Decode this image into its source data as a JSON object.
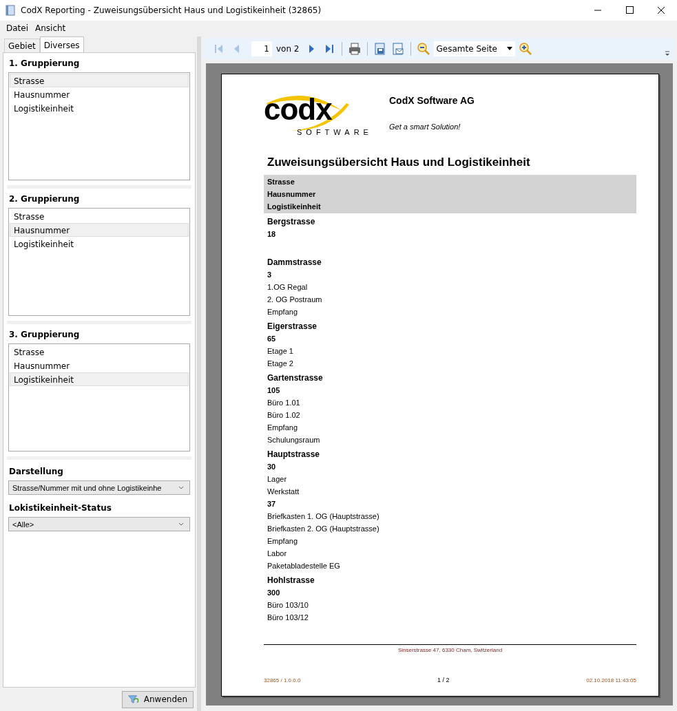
{
  "window": {
    "title": "CodX Reporting - Zuweisungsübersicht Haus und Logistikeinheit (32865)"
  },
  "menu": [
    "Datei",
    "Ansicht"
  ],
  "tabs": [
    {
      "label": "Gebiet",
      "selected": false
    },
    {
      "label": "Diverses",
      "selected": true
    }
  ],
  "groupings": [
    {
      "title": "1. Gruppierung",
      "items": [
        {
          "label": "Strasse",
          "selected": true
        },
        {
          "label": "Hausnummer",
          "selected": false
        },
        {
          "label": "Logistikeinheit",
          "selected": false
        }
      ]
    },
    {
      "title": "2. Gruppierung",
      "items": [
        {
          "label": "Strasse",
          "selected": false
        },
        {
          "label": "Hausnummer",
          "selected": true
        },
        {
          "label": "Logistikeinheit",
          "selected": false
        }
      ]
    },
    {
      "title": "3. Gruppierung",
      "items": [
        {
          "label": "Strasse",
          "selected": false
        },
        {
          "label": "Hausnummer",
          "selected": false
        },
        {
          "label": "Logistikeinheit",
          "selected": true
        }
      ]
    }
  ],
  "darstellung": {
    "label": "Darstellung",
    "value": "Strasse/Nummer mit und ohne Logistikeinhe"
  },
  "status": {
    "label": "Lokistikeinheit-Status",
    "value": "<Alle>"
  },
  "apply_button": "Anwenden",
  "toolbar": {
    "page": "1",
    "page_total": "von 2",
    "zoom": "Gesamte Seite"
  },
  "report": {
    "company": "CodX Software AG",
    "logo_text": "codx",
    "logo_sub": "SOFTWARE",
    "slogan": "Get a smart Solution!",
    "title": "Zuweisungsübersicht Haus und Logistikeinheit",
    "header": [
      "Strasse",
      "Hausnummer",
      "Logistikeinheit"
    ],
    "groups": [
      {
        "street": "Bergstrasse",
        "numbers": [
          {
            "number": "18"
          }
        ]
      },
      {
        "street": "Dammstrasse",
        "numbers": [
          {
            "number": "3",
            "units": [
              "1.OG Regal",
              "2. OG Postraum",
              "Empfang"
            ]
          }
        ]
      },
      {
        "street": "Eigerstrasse",
        "numbers": [
          {
            "number": "65",
            "units": [
              "Etage 1",
              "Etage 2"
            ]
          }
        ]
      },
      {
        "street": "Gartenstrasse",
        "numbers": [
          {
            "number": "105",
            "units": [
              "Büro 1.01",
              "Büro 1.02",
              "Empfang",
              "Schulungsraum"
            ]
          }
        ]
      },
      {
        "street": "Hauptstrasse",
        "numbers": [
          {
            "number": "30",
            "units": [
              "Lager",
              "Werkstatt"
            ]
          },
          {
            "number": "37",
            "units": [
              "Briefkasten 1. OG (Hauptstrasse)",
              "Briefkasten 2. OG  (Hauptstrasse)",
              "Empfang",
              "Labor",
              "Paketabladestelle EG"
            ]
          }
        ]
      },
      {
        "street": "Hohlstrasse",
        "numbers": [
          {
            "number": "300",
            "units": [
              "Büro 103/10",
              "Büro 103/12"
            ]
          }
        ]
      }
    ],
    "address": "Sinserstrasse 47, 6330 Cham, Switzerland",
    "footer_left": "32865 / 1.0.0.0",
    "footer_center": "1 / 2",
    "footer_right": "02.10.2018 11:43:05"
  }
}
